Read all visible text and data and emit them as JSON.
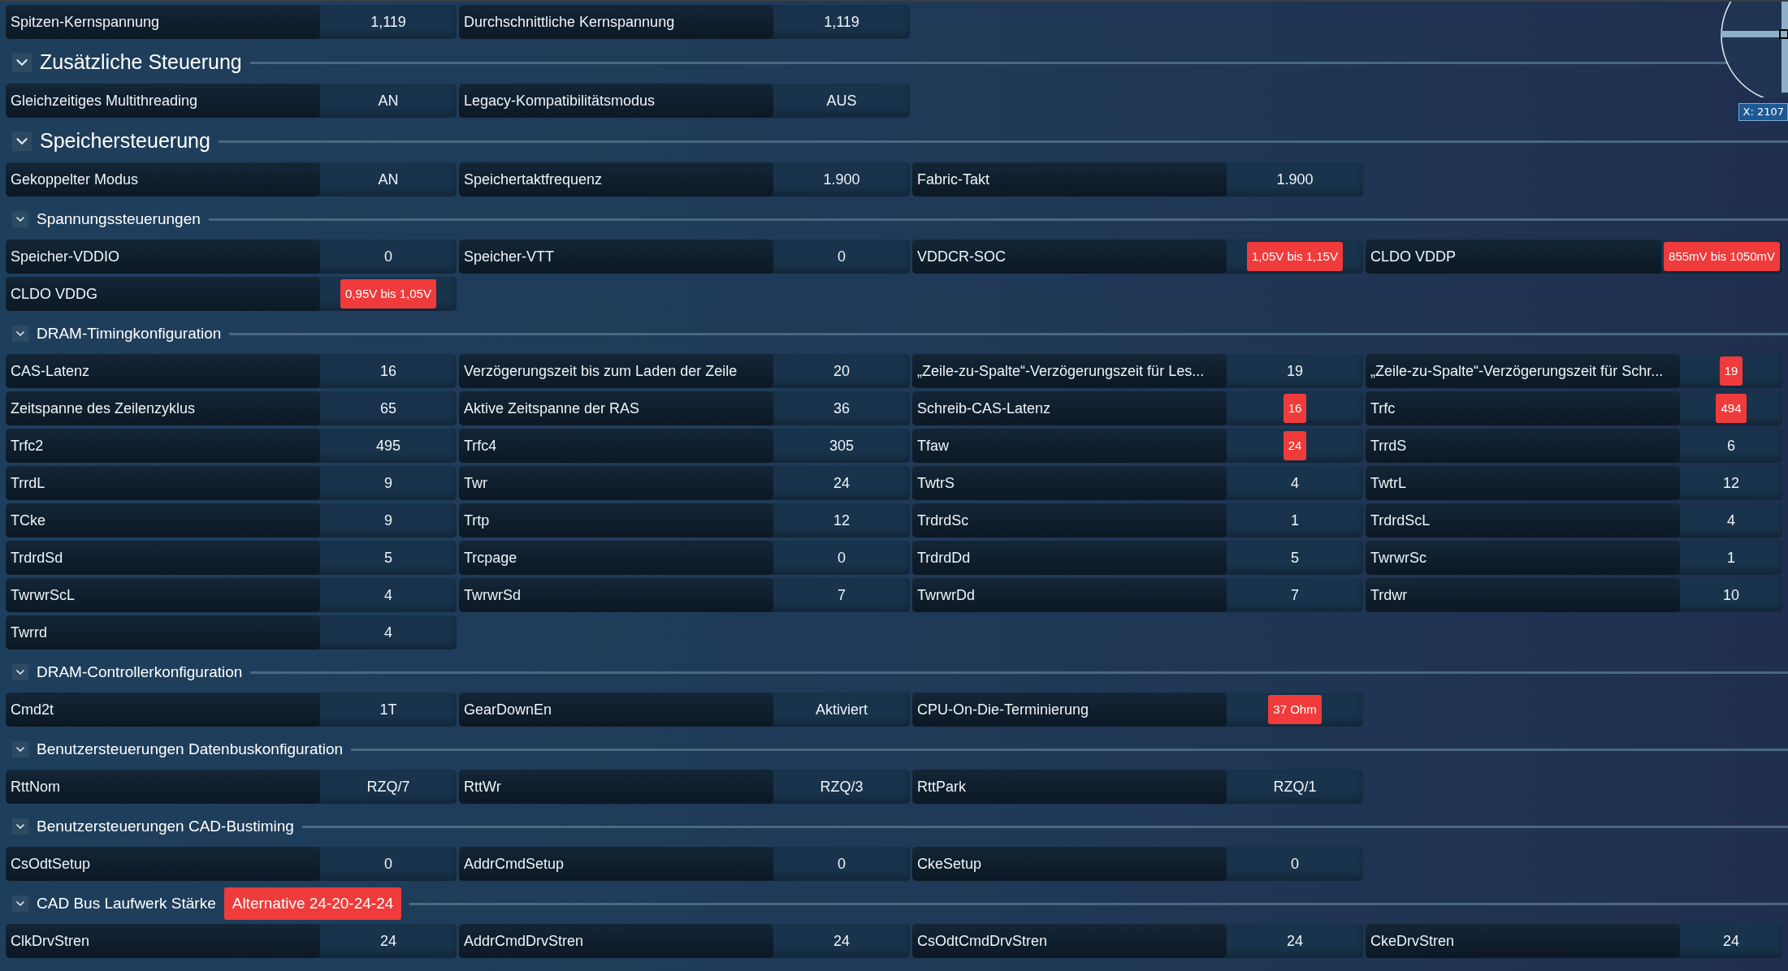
{
  "groups": [
    {
      "cells": [
        {
          "label": "Spitzen-Kernspannung",
          "value": "1,119",
          "highlighted": false
        },
        {
          "label": "Durchschnittliche Kernspannung",
          "value": "1,119",
          "highlighted": false
        }
      ]
    },
    {
      "heading": {
        "title": "Zusätzliche Steuerung",
        "kind": "major"
      },
      "cells": [
        {
          "label": "Gleichzeitiges Multithreading",
          "value": "AN",
          "highlighted": false
        },
        {
          "label": "Legacy-Kompatibilitätsmodus",
          "value": "AUS",
          "highlighted": false
        }
      ]
    },
    {
      "heading": {
        "title": "Speichersteuerung",
        "kind": "major"
      },
      "cells": [
        {
          "label": "Gekoppelter Modus",
          "value": "AN",
          "highlighted": false
        },
        {
          "label": "Speichertaktfrequenz",
          "value": "1.900",
          "highlighted": false
        },
        {
          "label": "Fabric-Takt",
          "value": "1.900",
          "highlighted": false
        }
      ]
    },
    {
      "heading": {
        "title": "Spannungssteuerungen",
        "kind": "minor"
      },
      "cells": [
        {
          "label": "Speicher-VDDIO",
          "value": "0",
          "highlighted": false
        },
        {
          "label": "Speicher-VTT",
          "value": "0",
          "highlighted": false
        },
        {
          "label": "VDDCR-SOC",
          "value": "1,05V bis 1,15V",
          "highlighted": true
        },
        {
          "label": "CLDO VDDP",
          "value": "855mV bis 1050mV",
          "highlighted": true
        },
        {
          "label": "CLDO VDDG",
          "value": "0,95V bis 1,05V",
          "highlighted": true
        }
      ]
    },
    {
      "heading": {
        "title": "DRAM-Timingkonfiguration",
        "kind": "minor"
      },
      "cells": [
        {
          "label": "CAS-Latenz",
          "value": "16",
          "highlighted": false
        },
        {
          "label": "Verzögerungszeit bis zum Laden der Zeile",
          "value": "20",
          "highlighted": false
        },
        {
          "label": "„Zeile-zu-Spalte“-Verzögerungszeit für Les...",
          "value": "19",
          "highlighted": false
        },
        {
          "label": "„Zeile-zu-Spalte“-Verzögerungszeit für Schr...",
          "value": "19",
          "highlighted": true
        },
        {
          "label": "Zeitspanne des Zeilenzyklus",
          "value": "65",
          "highlighted": false
        },
        {
          "label": "Aktive Zeitspanne der RAS",
          "value": "36",
          "highlighted": false
        },
        {
          "label": "Schreib-CAS-Latenz",
          "value": "16",
          "highlighted": true
        },
        {
          "label": "Trfc",
          "value": "494",
          "highlighted": true
        },
        {
          "label": "Trfc2",
          "value": "495",
          "highlighted": false
        },
        {
          "label": "Trfc4",
          "value": "305",
          "highlighted": false
        },
        {
          "label": "Tfaw",
          "value": "24",
          "highlighted": true
        },
        {
          "label": "TrrdS",
          "value": "6",
          "highlighted": false
        },
        {
          "label": "TrrdL",
          "value": "9",
          "highlighted": false
        },
        {
          "label": "Twr",
          "value": "24",
          "highlighted": false
        },
        {
          "label": "TwtrS",
          "value": "4",
          "highlighted": false
        },
        {
          "label": "TwtrL",
          "value": "12",
          "highlighted": false
        },
        {
          "label": "TCke",
          "value": "9",
          "highlighted": false
        },
        {
          "label": "Trtp",
          "value": "12",
          "highlighted": false
        },
        {
          "label": "TrdrdSc",
          "value": "1",
          "highlighted": false
        },
        {
          "label": "TrdrdScL",
          "value": "4",
          "highlighted": false
        },
        {
          "label": "TrdrdSd",
          "value": "5",
          "highlighted": false
        },
        {
          "label": "Trcpage",
          "value": "0",
          "highlighted": false
        },
        {
          "label": "TrdrdDd",
          "value": "5",
          "highlighted": false
        },
        {
          "label": "TwrwrSc",
          "value": "1",
          "highlighted": false
        },
        {
          "label": "TwrwrScL",
          "value": "4",
          "highlighted": false
        },
        {
          "label": "TwrwrSd",
          "value": "7",
          "highlighted": false
        },
        {
          "label": "TwrwrDd",
          "value": "7",
          "highlighted": false
        },
        {
          "label": "Trdwr",
          "value": "10",
          "highlighted": false
        },
        {
          "label": "Twrrd",
          "value": "4",
          "highlighted": false
        }
      ]
    },
    {
      "heading": {
        "title": "DRAM-Controllerkonfiguration",
        "kind": "minor"
      },
      "cells": [
        {
          "label": "Cmd2t",
          "value": "1T",
          "highlighted": false
        },
        {
          "label": "GearDownEn",
          "value": "Aktiviert",
          "highlighted": false
        },
        {
          "label": "CPU-On-Die-Terminierung",
          "value": "37 Ohm",
          "highlighted": true
        }
      ]
    },
    {
      "heading": {
        "title": "Benutzersteuerungen Datenbuskonfiguration",
        "kind": "minor"
      },
      "cells": [
        {
          "label": "RttNom",
          "value": "RZQ/7",
          "highlighted": false
        },
        {
          "label": "RttWr",
          "value": "RZQ/3",
          "highlighted": false
        },
        {
          "label": "RttPark",
          "value": "RZQ/1",
          "highlighted": false
        }
      ]
    },
    {
      "heading": {
        "title": "Benutzersteuerungen CAD-Bustiming",
        "kind": "minor"
      },
      "cells": [
        {
          "label": "CsOdtSetup",
          "value": "0",
          "highlighted": false
        },
        {
          "label": "AddrCmdSetup",
          "value": "0",
          "highlighted": false
        },
        {
          "label": "CkeSetup",
          "value": "0",
          "highlighted": false
        }
      ]
    },
    {
      "heading": {
        "title": "CAD Bus Laufwerk Stärke",
        "kind": "minor",
        "badge": "Alternative 24-20-24-24"
      },
      "cells": [
        {
          "label": "ClkDrvStren",
          "value": "24",
          "highlighted": false
        },
        {
          "label": "AddrCmdDrvStren",
          "value": "24",
          "highlighted": false
        },
        {
          "label": "CsOdtCmdDrvStren",
          "value": "24",
          "highlighted": false
        },
        {
          "label": "CkeDrvStren",
          "value": "24",
          "highlighted": false
        }
      ]
    }
  ],
  "magnifier": {
    "coordinates": "X: 2107"
  }
}
